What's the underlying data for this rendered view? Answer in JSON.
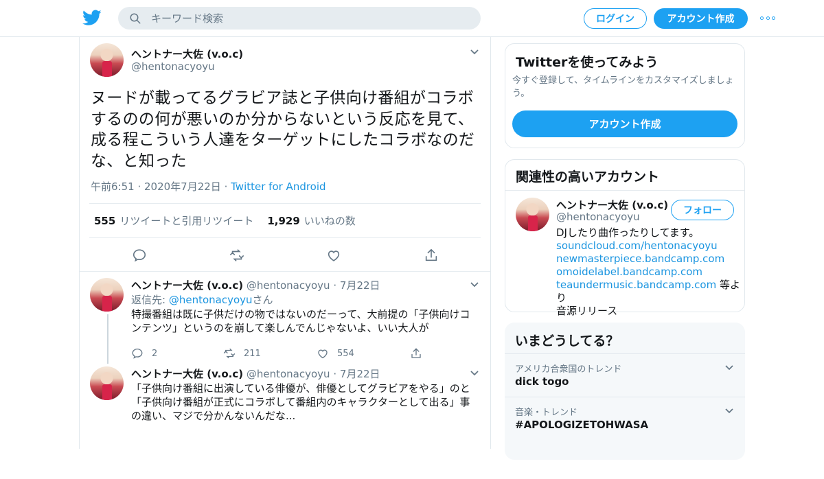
{
  "colors": {
    "brand": "#1da1f2",
    "link": "#1b95e0",
    "muted": "#657786",
    "text": "#14171a"
  },
  "header": {
    "search_placeholder": "キーワード検索",
    "login_label": "ログイン",
    "signup_label": "アカウント作成"
  },
  "main_tweet": {
    "name": "ヘントナー大佐 (v.o.c)",
    "handle": "@hentonacyoyu",
    "text": "ヌードが載ってるグラビア誌と子供向け番組がコラボするのの何が悪いのか分からないという反応を見て、成る程こういう人達をターゲットにしたコラボなのだな、と知った",
    "time": "午前6:51",
    "date": "2020年7月22日",
    "source": "Twitter for Android",
    "retweets": "555",
    "retweets_label": "リツイートと引用リツイート",
    "likes": "1,929",
    "likes_label": "いいねの数"
  },
  "replies": [
    {
      "name": "ヘントナー大佐 (v.o.c)",
      "handle": "@hentonacyoyu",
      "date": "7月22日",
      "reply_to_prefix": "返信先:",
      "reply_to_handle": "@hentonacyoyu",
      "reply_to_suffix": "さん",
      "text": "特撮番組は既に子供だけの物ではないのだーって、大前提の「子供向けコンテンツ」というのを崩して楽しんでんじゃないよ、いい大人が",
      "reply_count": "2",
      "retweet_count": "211",
      "like_count": "554"
    },
    {
      "name": "ヘントナー大佐 (v.o.c)",
      "handle": "@hentonacyoyu",
      "date": "7月22日",
      "text": "「子供向け番組に出演している俳優が、俳優としてグラビアをやる」のと「子供向け番組が正式にコラボして番組内のキャラクターとして出る」事の違い、マジで分かんないんだな...",
      "reply_count": "",
      "retweet_count": "",
      "like_count": ""
    }
  ],
  "signup_card": {
    "title": "Twitterを使ってみよう",
    "desc": "今すぐ登録して、タイムラインをカスタマイズしましょう。",
    "button": "アカウント作成"
  },
  "related": {
    "title": "関連性の高いアカウント",
    "name": "ヘントナー大佐 (v.o.c)",
    "handle": "@hentonacyoyu",
    "follow": "フォロー",
    "bio_line1": "DJしたり曲作ったりしてます。",
    "links": [
      "soundcloud.com/hentonacyoyu",
      "newmasterpiece.bandcamp.com",
      "omoidelabel.bandcamp.com",
      "teaundermusic.bandcamp.com"
    ],
    "bio_tail1": " 等より",
    "bio_tail2": "音源リリース"
  },
  "trends": {
    "title": "いまどうしてる？",
    "items": [
      {
        "context": "アメリカ合衆国のトレンド",
        "name": "dick togo"
      },
      {
        "context": "音楽・トレンド",
        "name": "#APOLOGIZETOHWASA"
      }
    ]
  }
}
